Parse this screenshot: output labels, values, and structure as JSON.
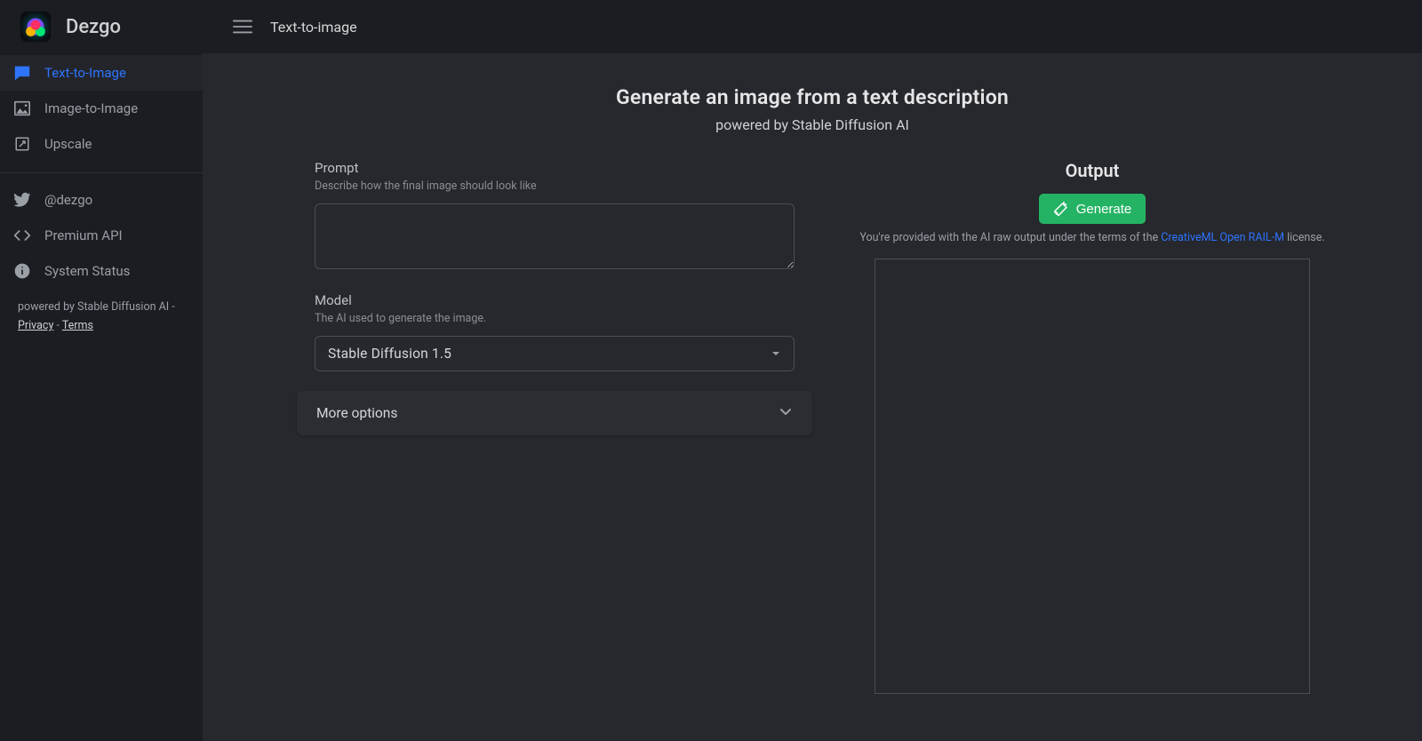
{
  "app": {
    "brand": "Dezgo",
    "page_name": "Text-to-image"
  },
  "sidebar": {
    "items": [
      {
        "id": "text-to-image",
        "label": "Text-to-Image",
        "icon": "message-icon",
        "active": true
      },
      {
        "id": "image-to-image",
        "label": "Image-to-Image",
        "icon": "image-icon",
        "active": false
      },
      {
        "id": "upscale",
        "label": "Upscale",
        "icon": "expand-icon",
        "active": false
      }
    ],
    "links": [
      {
        "id": "twitter",
        "label": "@dezgo",
        "icon": "twitter-icon"
      },
      {
        "id": "premium-api",
        "label": "Premium API",
        "icon": "code-icon"
      },
      {
        "id": "system-status",
        "label": "System Status",
        "icon": "info-icon"
      }
    ],
    "footer": {
      "powered": "powered by Stable Diffusion AI",
      "separator1": " - ",
      "privacy": "Privacy",
      "separator2": " - ",
      "terms": "Terms"
    }
  },
  "hero": {
    "title": "Generate an image from a text description",
    "subtitle": "powered by Stable Diffusion AI"
  },
  "form": {
    "prompt": {
      "label": "Prompt",
      "help": "Describe how the final image should look like",
      "value": ""
    },
    "model": {
      "label": "Model",
      "help": "The AI used to generate the image.",
      "selected": "Stable Diffusion 1.5"
    },
    "more_options": "More options"
  },
  "output": {
    "title": "Output",
    "generate": "Generate",
    "license_prefix": "You're provided with the AI raw output under the terms of the ",
    "license_link": "CreativeML Open RAIL-M",
    "license_suffix": " license."
  }
}
